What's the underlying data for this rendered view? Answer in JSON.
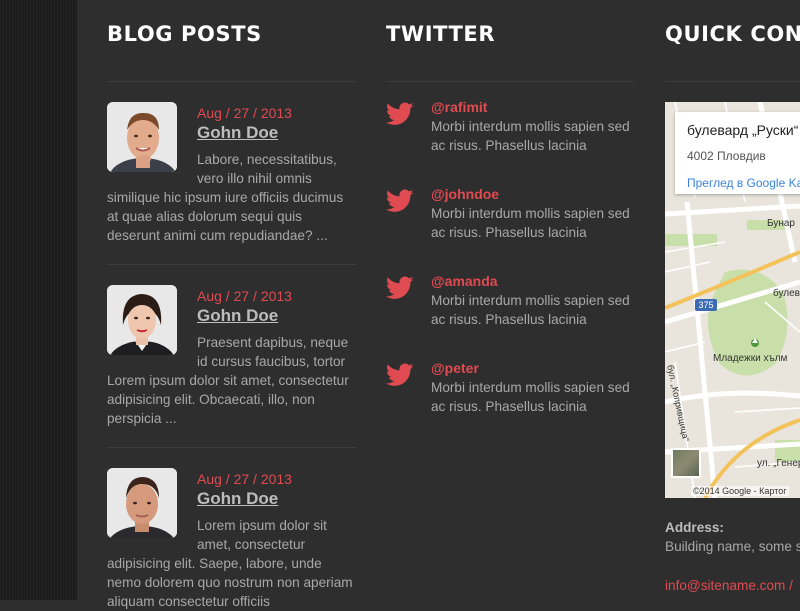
{
  "theme": {
    "accent": "#e04b52",
    "background": "#2e2e2e",
    "text": "#a8a8a8",
    "heading": "#ffffff"
  },
  "blog": {
    "title": "BLOG POSTS",
    "posts": [
      {
        "date": "Aug / 27 / 2013",
        "author": "Gohn Doe",
        "excerpt": "Labore, necessitatibus, vero illo nihil omnis similique hic ipsum iure officiis ducimus at quae alias dolorum sequi quis deserunt animi cum repudiandae? ..."
      },
      {
        "date": "Aug / 27 / 2013",
        "author": "Gohn Doe",
        "excerpt": "Praesent dapibus, neque id cursus faucibus, tortor Lorem ipsum dolor sit amet, consectetur adipisicing elit. Obcaecati, illo, non perspicia ..."
      },
      {
        "date": "Aug / 27 / 2013",
        "author": "Gohn Doe",
        "excerpt": "Lorem ipsum dolor sit amet, consectetur adipisicing elit. Saepe, labore, unde nemo dolorem quo nostrum non aperiam aliquam consectetur officiis"
      }
    ]
  },
  "twitter": {
    "title": "TWITTER",
    "icon": "twitter-bird-icon",
    "tweets": [
      {
        "handle": "@rafimit",
        "text": "Morbi interdum mollis sapien sed ac risus. Phasellus lacinia"
      },
      {
        "handle": "@johndoe",
        "text": "Morbi interdum mollis sapien sed ac risus. Phasellus lacinia"
      },
      {
        "handle": "@amanda",
        "text": "Morbi interdum mollis sapien sed ac risus. Phasellus lacinia"
      },
      {
        "handle": "@peter",
        "text": "Morbi interdum mollis sapien sed ac risus. Phasellus lacinia"
      }
    ]
  },
  "contact": {
    "title": "QUICK CONT",
    "map": {
      "place_name": "булевард „Руски“",
      "postal": "4002 Пловдив",
      "view_link": "Преглед в Google Ka",
      "labels": {
        "bunar": "Бунар",
        "bulv": "булев",
        "park": "Младежки хълм",
        "street_side": "бул. „Копривщица“",
        "ul": "ул. „Генер"
      },
      "road_number": "375",
      "copyright": "©2014 Google - Картог"
    },
    "address_label": "Address:",
    "address_value": "Building name, some s",
    "email": "info@sitename.com /"
  }
}
